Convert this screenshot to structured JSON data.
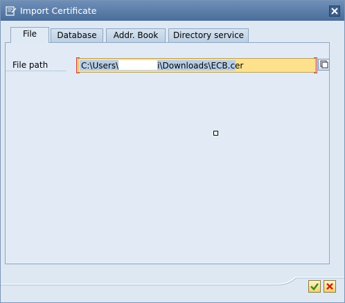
{
  "window": {
    "title": "Import Certificate"
  },
  "tabs": [
    {
      "label": "File",
      "active": true
    },
    {
      "label": "Database",
      "active": false
    },
    {
      "label": "Addr. Book",
      "active": false
    },
    {
      "label": "Directory service",
      "active": false
    }
  ],
  "form": {
    "file_path_label": "File path",
    "file_path_value_prefix": "C:\\Users\\",
    "file_path_value_suffix": "i\\Downloads\\ECB.cer"
  },
  "icons": {
    "title": "certificate-import-icon",
    "close": "close-icon",
    "value_help": "value-help-icon",
    "ok": "checkmark-icon",
    "cancel": "cancel-icon"
  },
  "colors": {
    "titlebar": "#4a6d99",
    "input_required": "#fde18d",
    "selection": "#b7cde6"
  }
}
